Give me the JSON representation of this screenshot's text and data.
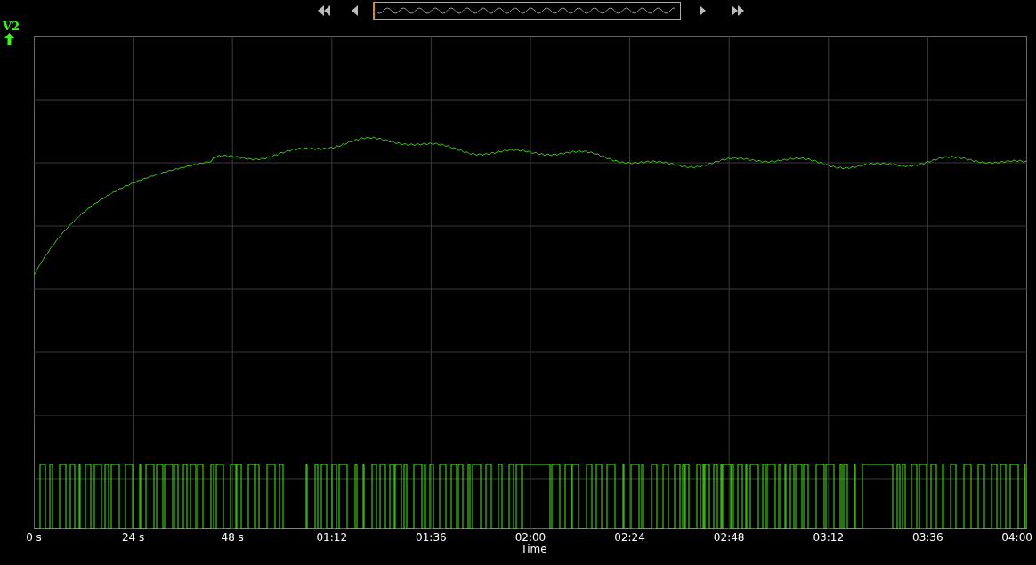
{
  "channel": {
    "label": "V2"
  },
  "x_axis": {
    "ticks": [
      "0 s",
      "24 s",
      "48 s",
      "01:12",
      "01:36",
      "02:00",
      "02:24",
      "02:48",
      "03:12",
      "03:36",
      "04:00"
    ],
    "title": "Time"
  }
}
